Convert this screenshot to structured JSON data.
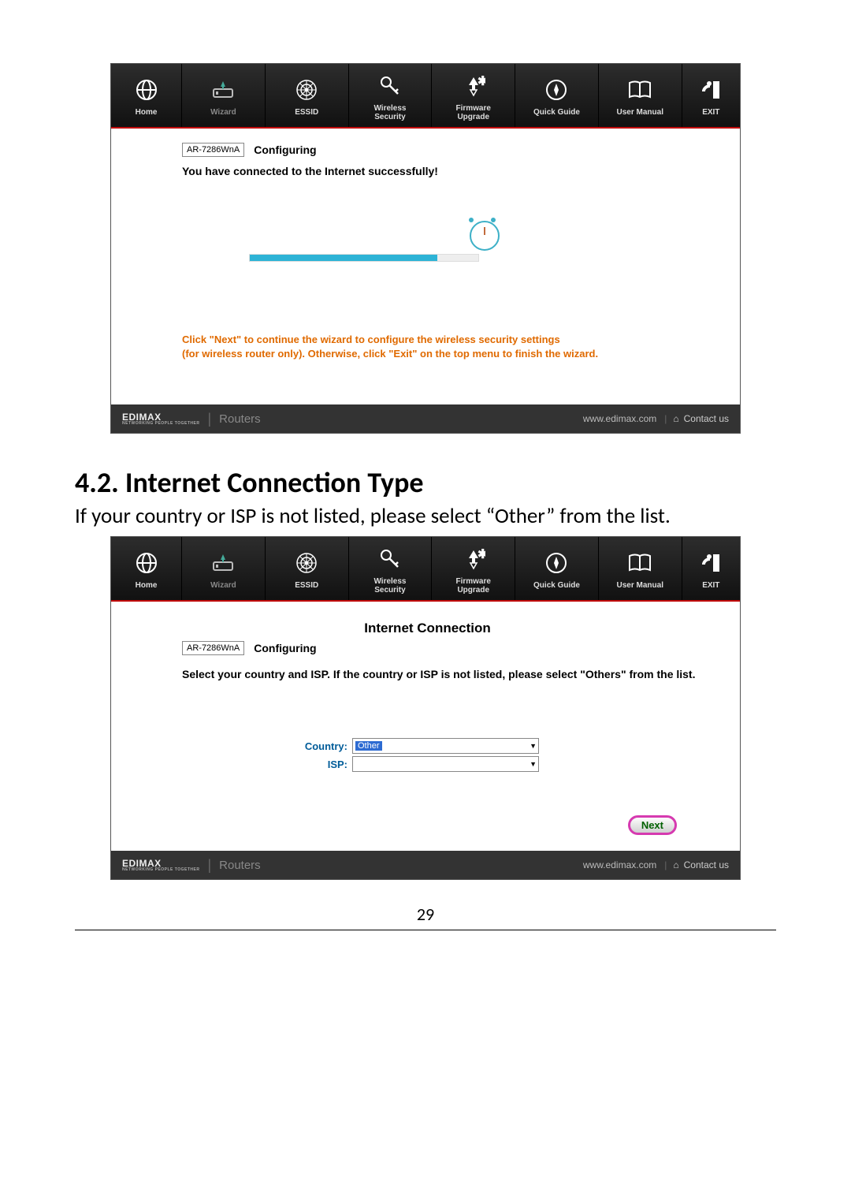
{
  "nav": {
    "home": "Home",
    "wizard": "Wizard",
    "essid": "ESSID",
    "wireless1": "Wireless",
    "wireless2": "Security",
    "firmware1": "Firmware",
    "firmware2": "Upgrade",
    "quick": "Quick Guide",
    "manual": "User Manual",
    "exit": "EXIT"
  },
  "shot1": {
    "model": "AR-7286WnA",
    "configuring": "Configuring",
    "success": "You have connected to the Internet successfully!",
    "hint1": "Click \"Next\" to continue the wizard to configure the wireless security settings",
    "hint2": "(for wireless router only). Otherwise, click \"Exit\" on the top menu to finish the wizard."
  },
  "shot2": {
    "title": "Internet Connection",
    "model": "AR-7286WnA",
    "configuring": "Configuring",
    "instruction": "Select your country and ISP. If the country or ISP is not listed, please select \"Others\" from the list.",
    "label_country": "Country:",
    "label_isp": "ISP:",
    "country_value": "Other",
    "isp_value": "",
    "next": "Next"
  },
  "foot": {
    "logo": "EDIMAX",
    "tag": "NETWORKING PEOPLE TOGETHER",
    "routers": "Routers",
    "url": "www.edimax.com",
    "contact": "Contact us"
  },
  "doc": {
    "section": "4.2. Internet Connection Type",
    "body": "If your country or ISP is not listed, please select “Other” from the list.",
    "pagenum": "29"
  }
}
